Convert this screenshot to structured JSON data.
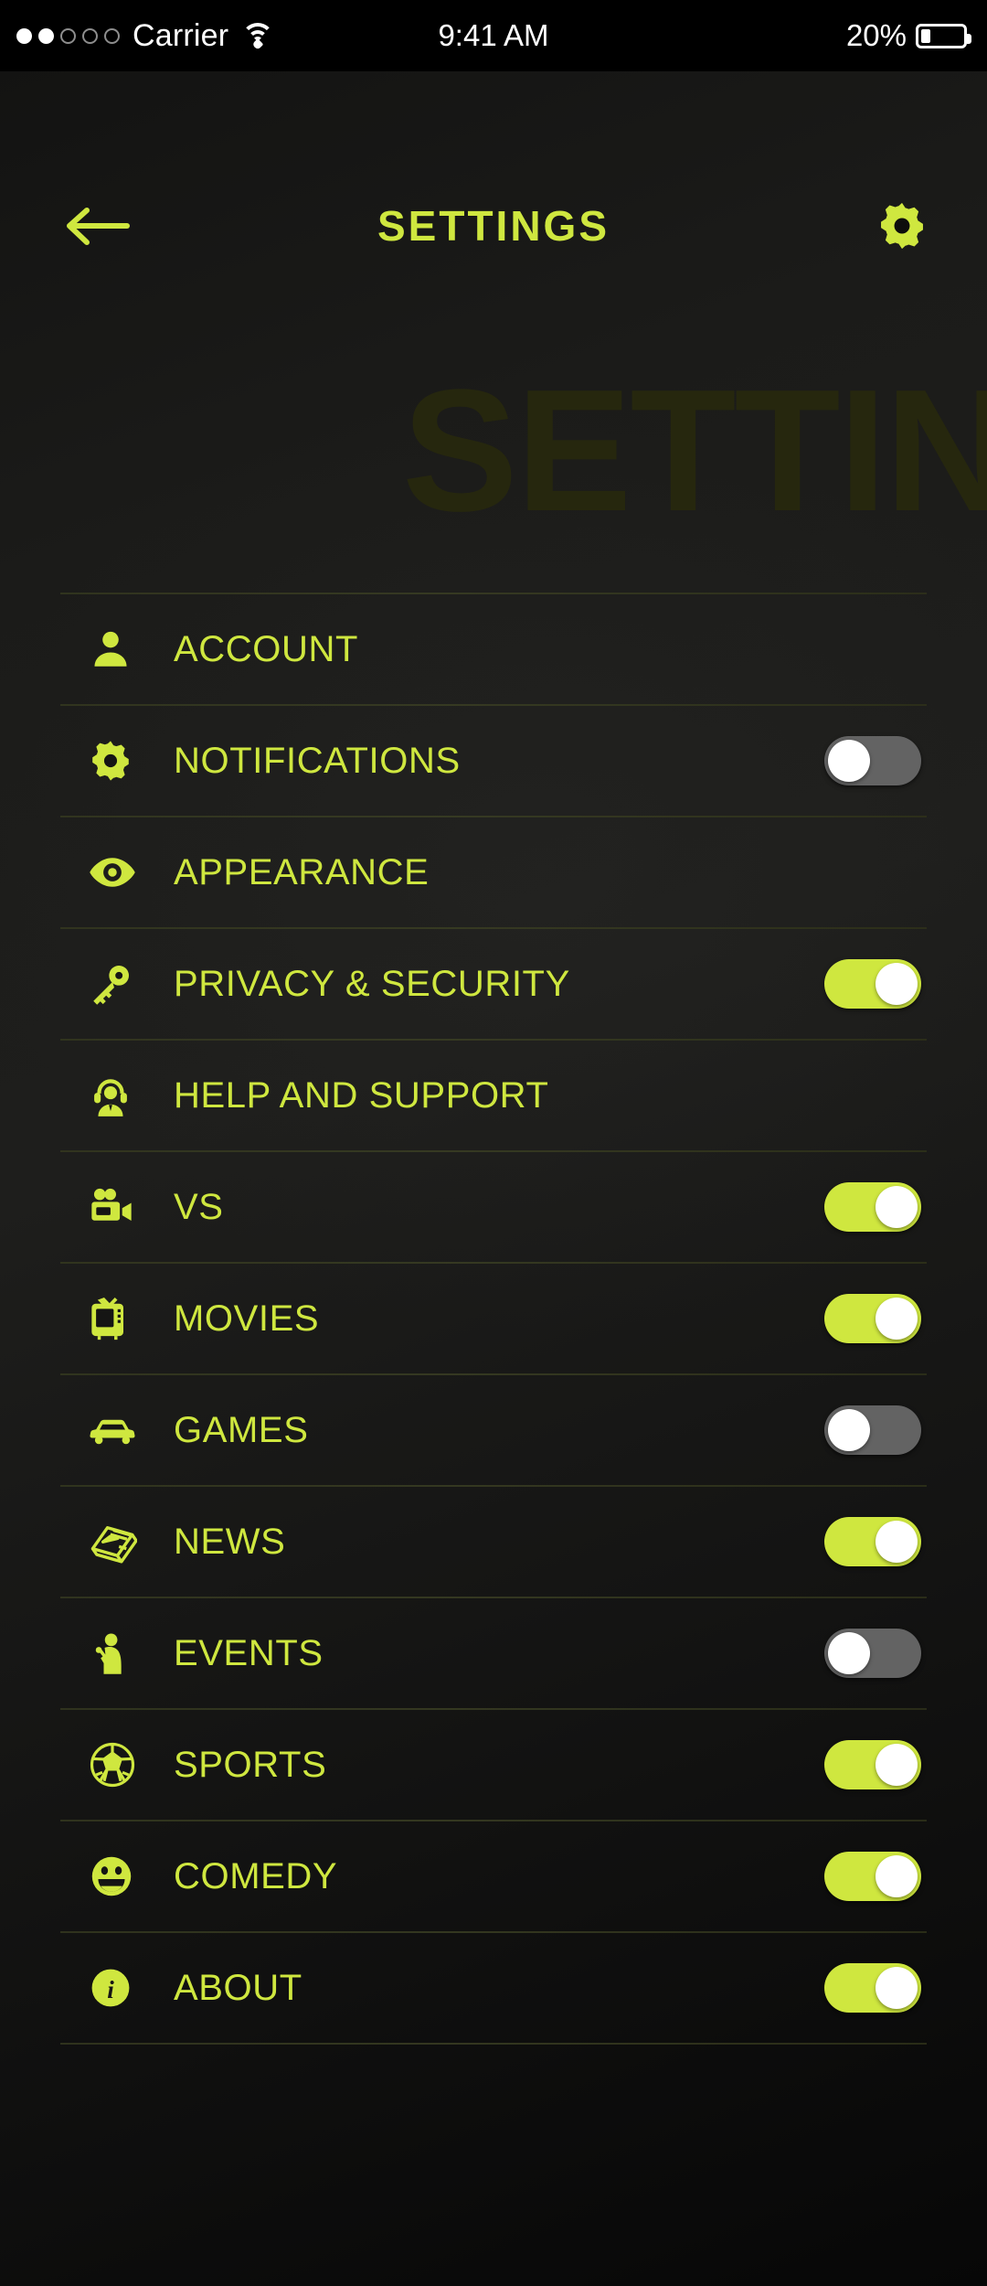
{
  "status_bar": {
    "signal_dots_filled": 2,
    "signal_dots_total": 5,
    "carrier": "Carrier",
    "wifi_icon": "wifi-icon",
    "time": "9:41 AM",
    "battery_percent": "20%",
    "battery_level": 20
  },
  "header": {
    "back_icon": "arrow-left-icon",
    "title": "SETTINGS",
    "gear_icon": "gear-icon"
  },
  "watermark": {
    "text": "SETTINGS"
  },
  "colors": {
    "accent": "#cfe73f",
    "background": "#121211",
    "toggle_on": "#cfe73f",
    "toggle_off": "#636363",
    "knob": "#ffffff",
    "divider": "#3a3e23",
    "watermark": "#26270e",
    "status_text": "#ffffff"
  },
  "list": {
    "items": [
      {
        "label": "ACCOUNT",
        "icon": "person-icon",
        "has_toggle": false,
        "toggle": null
      },
      {
        "label": "NOTIFICATIONS",
        "icon": "gear-icon",
        "has_toggle": true,
        "toggle": "off"
      },
      {
        "label": "APPEARANCE",
        "icon": "eye-icon",
        "has_toggle": false,
        "toggle": null
      },
      {
        "label": "PRIVACY & SECURITY",
        "icon": "key-icon",
        "has_toggle": true,
        "toggle": "on"
      },
      {
        "label": "HELP AND SUPPORT",
        "icon": "support-agent-icon",
        "has_toggle": false,
        "toggle": null
      },
      {
        "label": "VS",
        "icon": "movie-camera-icon",
        "has_toggle": true,
        "toggle": "on"
      },
      {
        "label": "MOVIES",
        "icon": "tv-icon",
        "has_toggle": true,
        "toggle": "on"
      },
      {
        "label": "GAMES",
        "icon": "car-icon",
        "has_toggle": true,
        "toggle": "off"
      },
      {
        "label": "NEWS",
        "icon": "newspaper-icon",
        "has_toggle": true,
        "toggle": "on"
      },
      {
        "label": "EVENTS",
        "icon": "performer-icon",
        "has_toggle": true,
        "toggle": "off"
      },
      {
        "label": "SPORTS",
        "icon": "soccer-ball-icon",
        "has_toggle": true,
        "toggle": "on"
      },
      {
        "label": "COMEDY",
        "icon": "smiley-icon",
        "has_toggle": true,
        "toggle": "on"
      },
      {
        "label": "ABOUT",
        "icon": "info-icon",
        "has_toggle": true,
        "toggle": "on"
      }
    ]
  }
}
